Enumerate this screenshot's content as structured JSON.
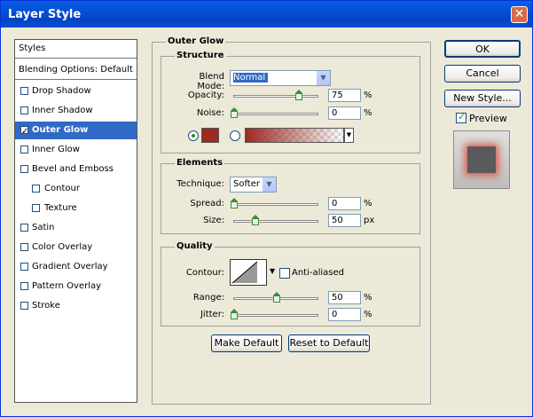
{
  "window": {
    "title": "Layer Style",
    "close_glyph": "✕"
  },
  "styles_list": {
    "header": "Styles",
    "blending": "Blending Options: Default",
    "items": [
      {
        "label": "Drop Shadow",
        "checked": false
      },
      {
        "label": "Inner Shadow",
        "checked": false
      },
      {
        "label": "Outer Glow",
        "checked": true
      },
      {
        "label": "Inner Glow",
        "checked": false
      },
      {
        "label": "Bevel and Emboss",
        "checked": false
      },
      {
        "label": "Contour",
        "checked": false
      },
      {
        "label": "Texture",
        "checked": false
      },
      {
        "label": "Satin",
        "checked": false
      },
      {
        "label": "Color Overlay",
        "checked": false
      },
      {
        "label": "Gradient Overlay",
        "checked": false
      },
      {
        "label": "Pattern Overlay",
        "checked": false
      },
      {
        "label": "Stroke",
        "checked": false
      }
    ]
  },
  "panel": {
    "title": "Outer Glow"
  },
  "structure": {
    "legend": "Structure",
    "blend_mode_label": "Blend Mode:",
    "blend_mode_value": "Normal",
    "opacity_label": "Opacity:",
    "opacity_value": "75",
    "opacity_unit": "%",
    "noise_label": "Noise:",
    "noise_value": "0",
    "noise_unit": "%",
    "color": "#9a2a22"
  },
  "elements": {
    "legend": "Elements",
    "technique_label": "Technique:",
    "technique_value": "Softer",
    "spread_label": "Spread:",
    "spread_value": "0",
    "spread_unit": "%",
    "size_label": "Size:",
    "size_value": "50",
    "size_unit": "px"
  },
  "quality": {
    "legend": "Quality",
    "contour_label": "Contour:",
    "antialiased_label": "Anti-aliased",
    "range_label": "Range:",
    "range_value": "50",
    "range_unit": "%",
    "jitter_label": "Jitter:",
    "jitter_value": "0",
    "jitter_unit": "%"
  },
  "buttons": {
    "make_default": "Make Default",
    "reset_default": "Reset to Default",
    "ok": "OK",
    "cancel": "Cancel",
    "new_style": "New Style...",
    "preview": "Preview"
  }
}
